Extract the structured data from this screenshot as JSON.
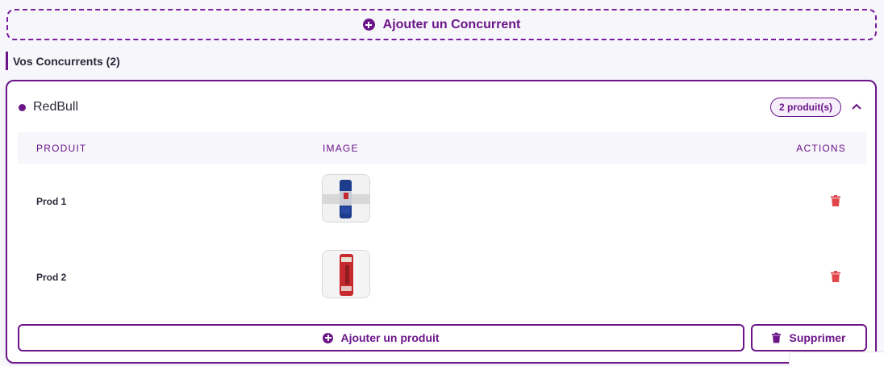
{
  "add_competitor": {
    "label": "Ajouter un Concurrent",
    "icon": "plus-circle-icon"
  },
  "section": {
    "title": "Vos Concurrents (2)"
  },
  "competitor": {
    "name": "RedBull",
    "badge": "2 produit(s)",
    "collapse_icon": "chevron-up-icon",
    "table": {
      "headers": {
        "product": "PRODUIT",
        "image": "IMAGE",
        "actions": "ACTIONS"
      },
      "rows": [
        {
          "name": "Prod 1",
          "image_icon": "blue-can-image",
          "action_icon": "trash-icon"
        },
        {
          "name": "Prod 2",
          "image_icon": "red-can-image",
          "action_icon": "trash-icon"
        }
      ]
    },
    "add_product": {
      "label": "Ajouter un produit",
      "icon": "plus-circle-icon"
    },
    "delete": {
      "label": "Supprimer",
      "icon": "trash-icon"
    }
  },
  "colors": {
    "accent": "#6b1589",
    "danger": "#e0474c",
    "background": "#f7f6fb"
  }
}
